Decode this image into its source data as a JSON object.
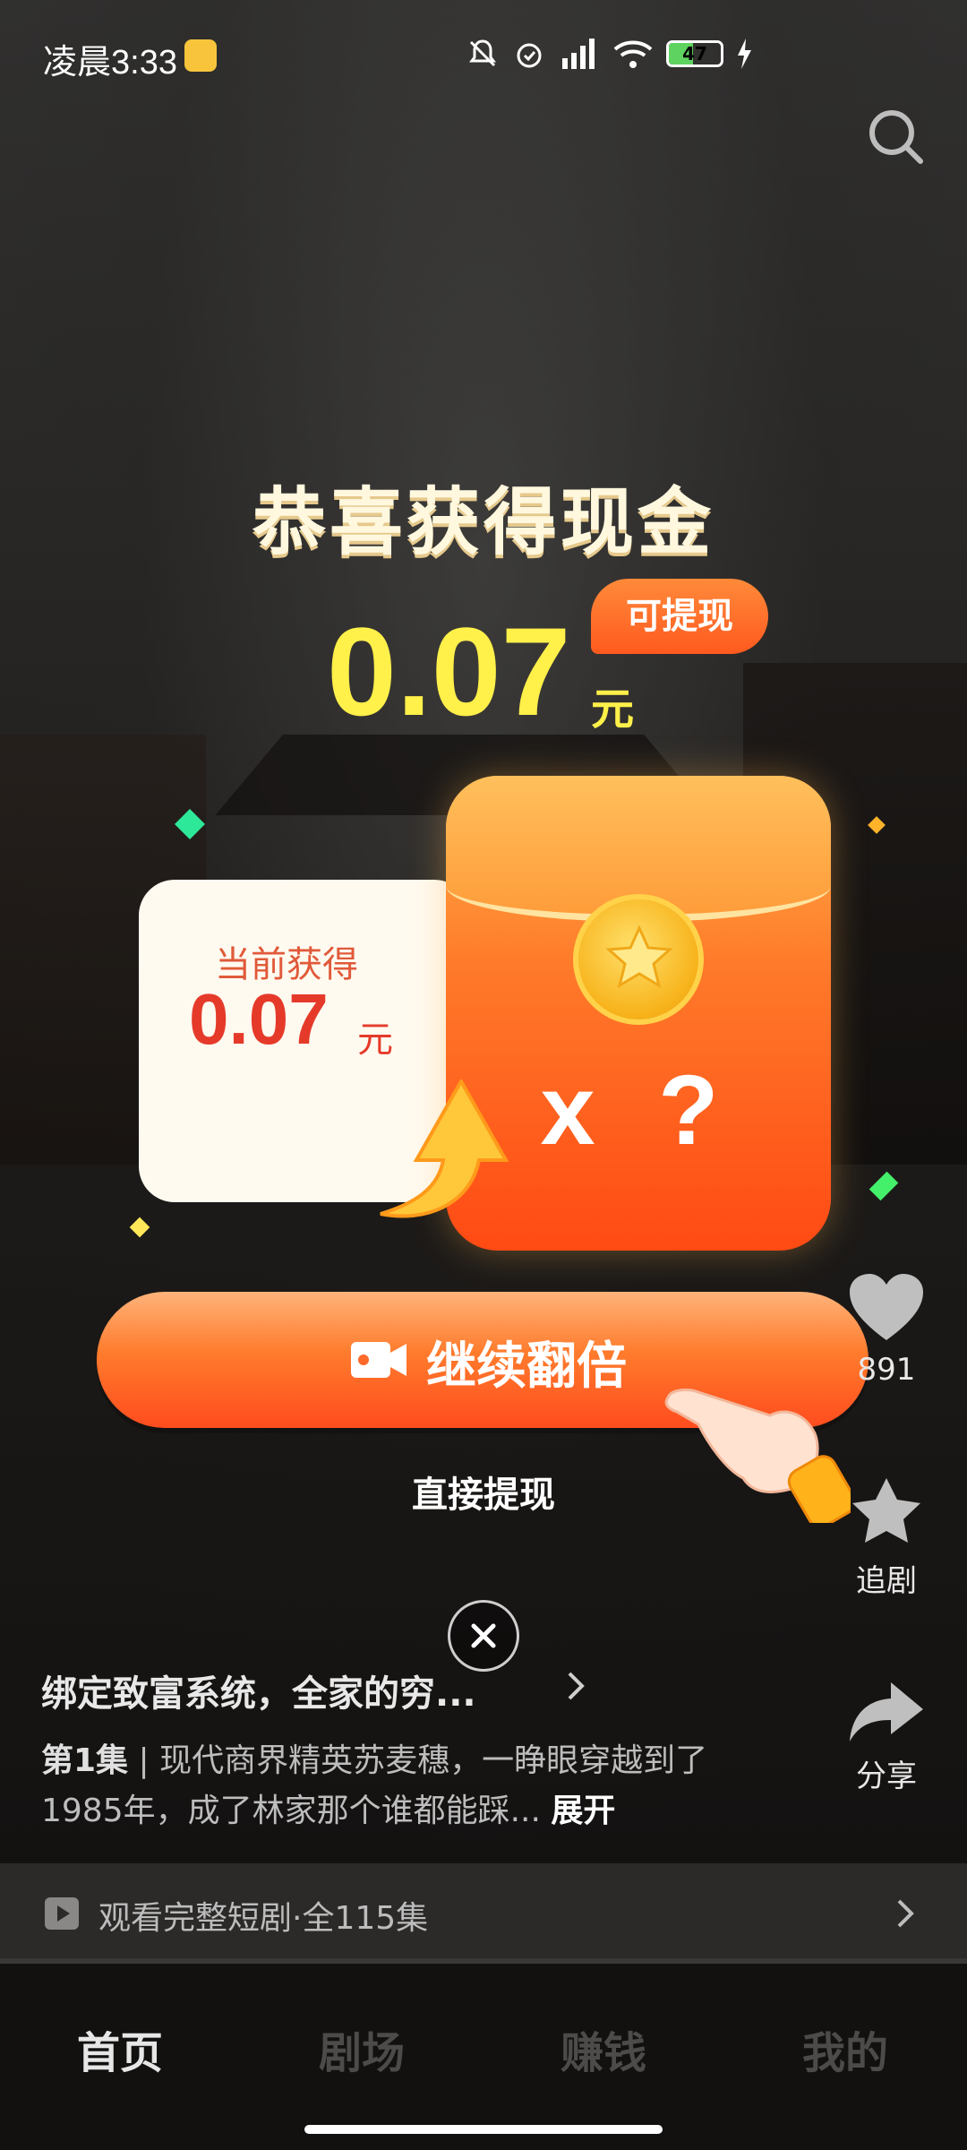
{
  "status_bar": {
    "time": "凌晨3:33",
    "battery": "47",
    "battery_level": 0.47
  },
  "reward": {
    "title": "恭喜获得现金",
    "amount": "0.07",
    "unit": "元",
    "badge": "可提现"
  },
  "card": {
    "label": "当前获得",
    "amount": "0.07",
    "unit": "元"
  },
  "envelope": {
    "multiplier": "x ?"
  },
  "actions": {
    "double_label": "继续翻倍",
    "direct_label": "直接提现"
  },
  "side_actions": {
    "like_count": "891",
    "follow_label": "追剧",
    "share_label": "分享"
  },
  "drama": {
    "title": "绑定致富系统，全家的穷...",
    "episode": "第1集",
    "description": "现代商界精英苏麦穗，一睁眼穿越到了1985年，成了林家那个谁都能踩...",
    "expand_label": "展开"
  },
  "watch_bar": {
    "label": "观看完整短剧·全115集"
  },
  "tabs": [
    "首页",
    "剧场",
    "赚钱",
    "我的"
  ],
  "colors": {
    "accent": "#ff5a1f",
    "amount_yellow": "#fff04a",
    "card_red": "#e53a2a"
  }
}
